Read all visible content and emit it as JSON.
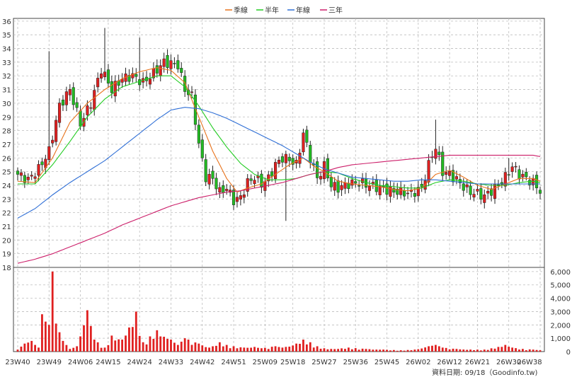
{
  "legend": {
    "items": [
      {
        "label": "季線",
        "color": "#e8731c"
      },
      {
        "label": "半年",
        "color": "#22cc22"
      },
      {
        "label": "年線",
        "color": "#2f6fd6"
      },
      {
        "label": "三年",
        "color": "#cc1f6a"
      }
    ]
  },
  "footer": {
    "text": "資料日期: 09/18（Goodinfo.tw)"
  },
  "chart_data": {
    "type": "candlestick",
    "price_axis": {
      "ticks": [
        18,
        19,
        20,
        21,
        22,
        23,
        24,
        25,
        26,
        27,
        28,
        29,
        30,
        31,
        32,
        33,
        34,
        35,
        36
      ],
      "ylim": [
        18,
        36.2
      ],
      "grid": true
    },
    "volume_axis": {
      "ticks": [
        0,
        1000,
        2000,
        3000,
        4000,
        5000,
        6000
      ],
      "tick_labels": [
        "0",
        "1,000",
        "2,000",
        "3,000",
        "4,000",
        "5,000",
        "6,000"
      ],
      "ylim": [
        0,
        6100
      ]
    },
    "x_ticks": [
      "23W40",
      "23W49",
      "24W06",
      "24W15",
      "24W24",
      "24W33",
      "24W42",
      "24W51",
      "25W09",
      "25W18",
      "25W27",
      "25W36",
      "25W45",
      "26W02",
      "26W12",
      "26W21",
      "26W30",
      "26W38"
    ],
    "close_keypoints": [
      [
        0,
        24.8
      ],
      [
        3,
        24.4
      ],
      [
        6,
        25.2
      ],
      [
        9,
        26.5
      ],
      [
        12,
        29.8
      ],
      [
        15,
        31.0
      ],
      [
        18,
        28.5
      ],
      [
        21,
        30.0
      ],
      [
        24,
        32.5
      ],
      [
        27,
        31.0
      ],
      [
        30,
        31.8
      ],
      [
        33,
        32.0
      ],
      [
        36,
        31.5
      ],
      [
        39,
        32.2
      ],
      [
        42,
        33.0
      ],
      [
        46,
        32.8
      ],
      [
        48,
        31.0
      ],
      [
        50,
        30.5
      ],
      [
        52,
        27.0
      ],
      [
        54,
        24.6
      ],
      [
        56,
        24.5
      ],
      [
        58,
        23.5
      ],
      [
        60,
        23.8
      ],
      [
        62,
        22.9
      ],
      [
        64,
        23.1
      ],
      [
        66,
        24.2
      ],
      [
        68,
        24.6
      ],
      [
        70,
        24.1
      ],
      [
        72,
        24.5
      ],
      [
        74,
        25.5
      ],
      [
        76,
        26.0
      ],
      [
        78,
        25.9
      ],
      [
        80,
        25.5
      ],
      [
        82,
        27.8
      ],
      [
        84,
        26.0
      ],
      [
        86,
        24.5
      ],
      [
        88,
        25.4
      ],
      [
        90,
        24.0
      ],
      [
        92,
        23.8
      ],
      [
        95,
        24.1
      ],
      [
        98,
        24.2
      ],
      [
        101,
        24.0
      ],
      [
        104,
        23.8
      ],
      [
        107,
        23.6
      ],
      [
        110,
        23.5
      ],
      [
        113,
        23.4
      ],
      [
        116,
        23.8
      ],
      [
        118,
        25.5
      ],
      [
        120,
        26.8
      ],
      [
        122,
        25.0
      ],
      [
        124,
        24.8
      ],
      [
        126,
        24.4
      ],
      [
        128,
        23.9
      ],
      [
        130,
        23.5
      ],
      [
        132,
        23.4
      ],
      [
        134,
        23.2
      ],
      [
        136,
        23.6
      ],
      [
        138,
        24.0
      ],
      [
        140,
        24.6
      ],
      [
        142,
        25.4
      ],
      [
        144,
        24.8
      ],
      [
        146,
        24.5
      ],
      [
        148,
        24.2
      ],
      [
        150,
        23.6
      ]
    ],
    "spikes": [
      {
        "i": 9,
        "high": 33.8
      },
      {
        "i": 25,
        "high": 35.5
      },
      {
        "i": 35,
        "high": 34.8
      },
      {
        "i": 77,
        "low": 21.4
      },
      {
        "i": 120,
        "high": 28.8
      },
      {
        "i": 141,
        "high": 26.0
      }
    ],
    "ma_series": [
      {
        "name": "季線",
        "color": "#e8731c",
        "points": [
          [
            0,
            24.3
          ],
          [
            5,
            24.2
          ],
          [
            10,
            26.0
          ],
          [
            15,
            28.6
          ],
          [
            20,
            30.0
          ],
          [
            25,
            31.0
          ],
          [
            30,
            31.8
          ],
          [
            35,
            32.3
          ],
          [
            40,
            32.6
          ],
          [
            44,
            32.4
          ],
          [
            48,
            31.5
          ],
          [
            52,
            29.0
          ],
          [
            56,
            26.5
          ],
          [
            60,
            24.5
          ],
          [
            63,
            23.5
          ],
          [
            66,
            23.8
          ],
          [
            70,
            24.1
          ],
          [
            74,
            24.8
          ],
          [
            78,
            25.5
          ],
          [
            82,
            26.0
          ],
          [
            85,
            25.4
          ],
          [
            88,
            25.0
          ],
          [
            92,
            24.3
          ],
          [
            96,
            24.1
          ],
          [
            100,
            24.0
          ],
          [
            104,
            23.9
          ],
          [
            108,
            23.7
          ],
          [
            112,
            23.6
          ],
          [
            116,
            23.8
          ],
          [
            120,
            24.8
          ],
          [
            124,
            25.1
          ],
          [
            128,
            24.6
          ],
          [
            132,
            24.0
          ],
          [
            136,
            23.7
          ],
          [
            140,
            24.1
          ],
          [
            144,
            24.5
          ],
          [
            148,
            24.5
          ],
          [
            150,
            24.3
          ]
        ]
      },
      {
        "name": "半年",
        "color": "#22cc22",
        "points": [
          [
            0,
            24.1
          ],
          [
            5,
            24.1
          ],
          [
            10,
            25.5
          ],
          [
            15,
            27.2
          ],
          [
            20,
            29.0
          ],
          [
            25,
            30.3
          ],
          [
            30,
            31.2
          ],
          [
            35,
            31.6
          ],
          [
            40,
            32.0
          ],
          [
            44,
            32.0
          ],
          [
            48,
            31.2
          ],
          [
            52,
            29.8
          ],
          [
            56,
            28.2
          ],
          [
            60,
            26.8
          ],
          [
            64,
            25.6
          ],
          [
            68,
            24.8
          ],
          [
            72,
            24.4
          ],
          [
            76,
            24.4
          ],
          [
            80,
            24.5
          ],
          [
            84,
            24.8
          ],
          [
            88,
            25.0
          ],
          [
            92,
            24.9
          ],
          [
            96,
            24.5
          ],
          [
            100,
            24.2
          ],
          [
            104,
            24.0
          ],
          [
            108,
            23.9
          ],
          [
            112,
            23.8
          ],
          [
            116,
            23.8
          ],
          [
            120,
            24.2
          ],
          [
            124,
            24.4
          ],
          [
            128,
            24.3
          ],
          [
            132,
            24.1
          ],
          [
            136,
            24.0
          ],
          [
            140,
            24.0
          ],
          [
            144,
            24.2
          ],
          [
            148,
            24.3
          ],
          [
            150,
            24.2
          ]
        ]
      },
      {
        "name": "年線",
        "color": "#2f6fd6",
        "points": [
          [
            0,
            21.6
          ],
          [
            5,
            22.3
          ],
          [
            10,
            23.3
          ],
          [
            15,
            24.2
          ],
          [
            20,
            25.0
          ],
          [
            25,
            25.8
          ],
          [
            30,
            26.8
          ],
          [
            35,
            27.8
          ],
          [
            40,
            28.8
          ],
          [
            44,
            29.5
          ],
          [
            48,
            29.7
          ],
          [
            52,
            29.6
          ],
          [
            56,
            29.3
          ],
          [
            60,
            28.9
          ],
          [
            64,
            28.4
          ],
          [
            68,
            27.9
          ],
          [
            72,
            27.4
          ],
          [
            76,
            26.9
          ],
          [
            80,
            26.3
          ],
          [
            84,
            25.7
          ],
          [
            88,
            25.2
          ],
          [
            92,
            24.9
          ],
          [
            96,
            24.6
          ],
          [
            100,
            24.5
          ],
          [
            104,
            24.4
          ],
          [
            108,
            24.3
          ],
          [
            112,
            24.3
          ],
          [
            116,
            24.4
          ],
          [
            120,
            24.4
          ],
          [
            124,
            24.3
          ],
          [
            128,
            24.2
          ],
          [
            132,
            24.1
          ],
          [
            136,
            24.1
          ],
          [
            140,
            24.1
          ],
          [
            144,
            24.1
          ],
          [
            148,
            24.1
          ],
          [
            150,
            24.1
          ]
        ]
      },
      {
        "name": "三年",
        "color": "#cc1f6a",
        "points": [
          [
            0,
            18.3
          ],
          [
            5,
            18.6
          ],
          [
            10,
            19.0
          ],
          [
            15,
            19.5
          ],
          [
            20,
            20.0
          ],
          [
            25,
            20.5
          ],
          [
            30,
            21.1
          ],
          [
            35,
            21.6
          ],
          [
            40,
            22.1
          ],
          [
            44,
            22.5
          ],
          [
            48,
            22.8
          ],
          [
            52,
            23.1
          ],
          [
            56,
            23.3
          ],
          [
            60,
            23.5
          ],
          [
            64,
            23.6
          ],
          [
            68,
            23.8
          ],
          [
            72,
            24.0
          ],
          [
            76,
            24.2
          ],
          [
            80,
            24.5
          ],
          [
            84,
            24.8
          ],
          [
            88,
            25.0
          ],
          [
            92,
            25.3
          ],
          [
            96,
            25.5
          ],
          [
            100,
            25.6
          ],
          [
            104,
            25.7
          ],
          [
            108,
            25.8
          ],
          [
            112,
            25.9
          ],
          [
            116,
            26.0
          ],
          [
            120,
            26.1
          ],
          [
            124,
            26.2
          ],
          [
            128,
            26.2
          ],
          [
            132,
            26.2
          ],
          [
            136,
            26.2
          ],
          [
            140,
            26.2
          ],
          [
            144,
            26.2
          ],
          [
            148,
            26.2
          ],
          [
            150,
            26.1
          ]
        ]
      }
    ],
    "volume_keypoints": [
      [
        0,
        150
      ],
      [
        2,
        600
      ],
      [
        4,
        800
      ],
      [
        6,
        300
      ],
      [
        7,
        2800
      ],
      [
        9,
        2000
      ],
      [
        10,
        6000
      ],
      [
        11,
        2100
      ],
      [
        13,
        800
      ],
      [
        15,
        200
      ],
      [
        17,
        400
      ],
      [
        20,
        3100
      ],
      [
        22,
        900
      ],
      [
        25,
        300
      ],
      [
        27,
        1200
      ],
      [
        30,
        900
      ],
      [
        34,
        3000
      ],
      [
        36,
        700
      ],
      [
        40,
        1600
      ],
      [
        44,
        900
      ],
      [
        46,
        500
      ],
      [
        48,
        1000
      ],
      [
        52,
        600
      ],
      [
        55,
        300
      ],
      [
        58,
        700
      ],
      [
        60,
        500
      ],
      [
        62,
        400
      ],
      [
        65,
        300
      ],
      [
        68,
        350
      ],
      [
        70,
        250
      ],
      [
        74,
        400
      ],
      [
        76,
        300
      ],
      [
        80,
        600
      ],
      [
        82,
        900
      ],
      [
        84,
        700
      ],
      [
        86,
        400
      ],
      [
        88,
        250
      ],
      [
        90,
        200
      ],
      [
        95,
        300
      ],
      [
        100,
        200
      ],
      [
        105,
        150
      ],
      [
        110,
        100
      ],
      [
        114,
        150
      ],
      [
        118,
        400
      ],
      [
        120,
        500
      ],
      [
        122,
        300
      ],
      [
        126,
        200
      ],
      [
        130,
        150
      ],
      [
        134,
        150
      ],
      [
        138,
        350
      ],
      [
        140,
        500
      ],
      [
        142,
        300
      ],
      [
        145,
        200
      ],
      [
        148,
        150
      ],
      [
        150,
        100
      ]
    ],
    "n_periods": 151
  }
}
